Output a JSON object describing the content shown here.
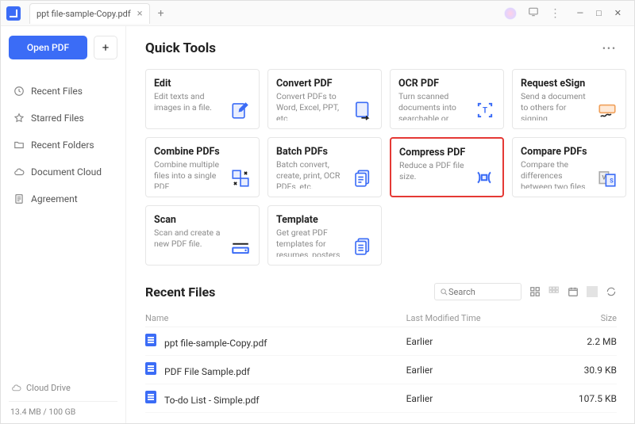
{
  "titlebar": {
    "tab_title": "ppt file-sample-Copy.pdf"
  },
  "sidebar": {
    "open_label": "Open PDF",
    "nav": [
      {
        "label": "Recent Files",
        "icon": "clock"
      },
      {
        "label": "Starred Files",
        "icon": "star"
      },
      {
        "label": "Recent Folders",
        "icon": "folder"
      },
      {
        "label": "Document Cloud",
        "icon": "cloud"
      },
      {
        "label": "Agreement",
        "icon": "doc"
      }
    ],
    "cloud_label": "Cloud Drive",
    "storage_text": "13.4 MB / 100 GB"
  },
  "quick_tools": {
    "title": "Quick Tools",
    "items": [
      {
        "title": "Edit",
        "desc": "Edit texts and images in a file."
      },
      {
        "title": "Convert PDF",
        "desc": "Convert PDFs to Word, Excel, PPT, etc."
      },
      {
        "title": "OCR PDF",
        "desc": "Turn scanned documents into searchable or edita…"
      },
      {
        "title": "Request eSign",
        "desc": "Send a document to others for signing."
      },
      {
        "title": "Combine PDFs",
        "desc": "Combine multiple files into a single PDF."
      },
      {
        "title": "Batch PDFs",
        "desc": "Batch convert, create, print, OCR PDFs, etc."
      },
      {
        "title": "Compress PDF",
        "desc": "Reduce a PDF file size."
      },
      {
        "title": "Compare PDFs",
        "desc": "Compare the differences between two files."
      },
      {
        "title": "Scan",
        "desc": "Scan and create a new PDF file."
      },
      {
        "title": "Template",
        "desc": "Get great PDF templates for resumes, posters, e…"
      }
    ]
  },
  "recent": {
    "title": "Recent Files",
    "search_placeholder": "Search",
    "columns": {
      "name": "Name",
      "time": "Last Modified Time",
      "size": "Size"
    },
    "rows": [
      {
        "name": "ppt file-sample-Copy.pdf",
        "time": "Earlier",
        "size": "2.2 MB"
      },
      {
        "name": "PDF File Sample.pdf",
        "time": "Earlier",
        "size": "30.9 KB"
      },
      {
        "name": "To-do List - Simple.pdf",
        "time": "Earlier",
        "size": "107.5 KB"
      }
    ]
  }
}
